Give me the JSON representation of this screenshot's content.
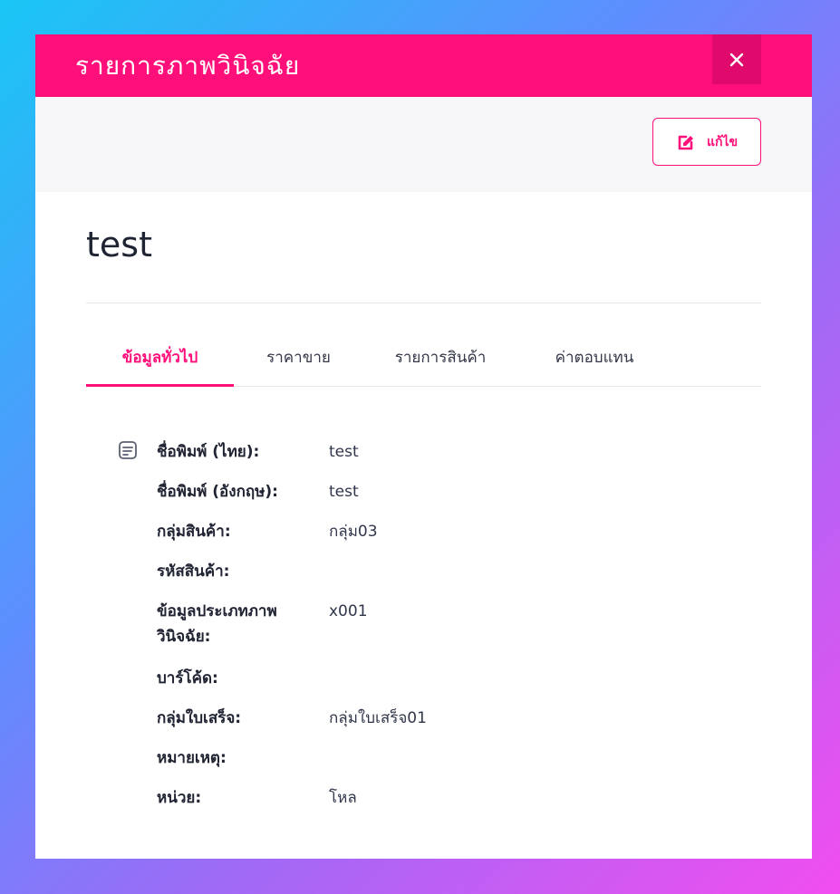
{
  "modal": {
    "title": "รายการภาพวินิจฉัย",
    "close_label": "×",
    "edit_label": "แก้ไข",
    "record_title": "test",
    "tabs": [
      {
        "label": "ข้อมูลทั่วไป",
        "active": true
      },
      {
        "label": "ราคาขาย",
        "active": false
      },
      {
        "label": "รายการสินค้า",
        "active": false
      },
      {
        "label": "ค่าตอบแทน",
        "active": false
      }
    ],
    "fields": [
      {
        "label": "ชื่อพิมพ์ (ไทย):",
        "value": "test"
      },
      {
        "label": "ชื่อพิมพ์ (อังกฤษ):",
        "value": "test"
      },
      {
        "label": "กลุ่มสินค้า:",
        "value": "กลุ่ม03"
      },
      {
        "label": "รหัสสินค้า:",
        "value": ""
      },
      {
        "label": "ข้อมูลประเภทภาพวินิจฉัย:",
        "value": "x001"
      },
      {
        "label": "บาร์โค้ด:",
        "value": ""
      },
      {
        "label": "กลุ่มใบเสร็จ:",
        "value": "กลุ่มใบเสร็จ01"
      },
      {
        "label": "หมายเหตุ:",
        "value": ""
      },
      {
        "label": "หน่วย:",
        "value": "โหล"
      }
    ]
  },
  "colors": {
    "accent": "#ff0f7a",
    "accent_dark": "#e00a6c",
    "toolbar_bg": "#f7f7f9",
    "text_dark": "#1f2433"
  },
  "icons": {
    "close": "close-icon",
    "edit": "edit-icon",
    "details": "document-list-icon"
  }
}
